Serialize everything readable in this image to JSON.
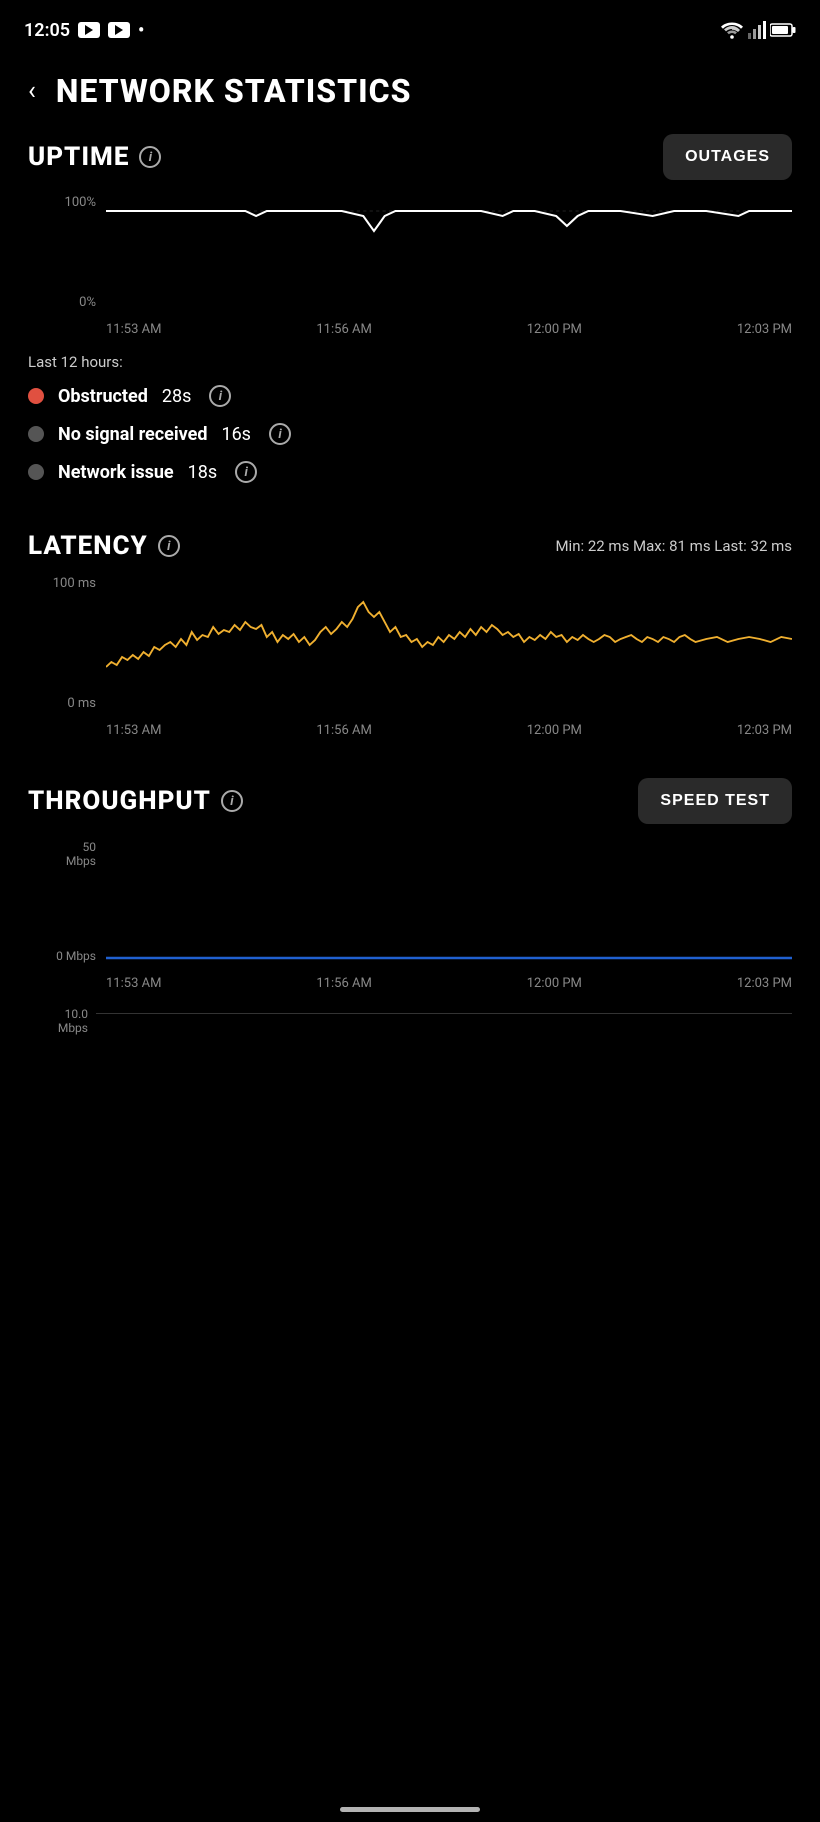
{
  "status_bar": {
    "time": "12:05",
    "dot": "•"
  },
  "header": {
    "back_label": "‹",
    "title": "NETWORK STATISTICS"
  },
  "uptime": {
    "title": "UPTIME",
    "button_label": "OUTAGES",
    "y_labels": [
      "100%",
      "0%"
    ],
    "x_labels": [
      "11:53 AM",
      "11:56 AM",
      "12:00 PM",
      "12:03 PM"
    ],
    "legend_title": "Last 12 hours:",
    "legend_items": [
      {
        "type": "red",
        "label": "Obstructed",
        "value": "28s"
      },
      {
        "type": "gray",
        "label": "No signal received",
        "value": "16s"
      },
      {
        "type": "gray",
        "label": "Network issue",
        "value": "18s"
      }
    ]
  },
  "latency": {
    "title": "LATENCY",
    "stats": "Min: 22 ms  Max: 81 ms  Last: 32 ms",
    "y_labels": [
      "100 ms",
      "0 ms"
    ],
    "x_labels": [
      "11:53 AM",
      "11:56 AM",
      "12:00 PM",
      "12:03 PM"
    ]
  },
  "throughput": {
    "title": "THROUGHPUT",
    "button_label": "SPEED TEST",
    "y_labels_top": [
      "50\nMbps",
      "0 Mbps"
    ],
    "y_label_50": "50",
    "y_label_50_unit": "Mbps",
    "y_label_0": "0 Mbps",
    "y_label_bottom": "10.0\nMbps",
    "x_labels": [
      "11:53 AM",
      "11:56 AM",
      "12:00 PM",
      "12:03 PM"
    ]
  },
  "icons": {
    "wifi": "wifi-icon",
    "cell": "cell-signal-icon",
    "battery": "battery-icon",
    "back": "back-arrow-icon",
    "info": "info-icon"
  }
}
